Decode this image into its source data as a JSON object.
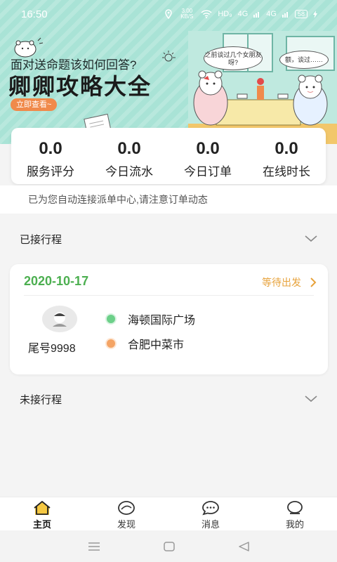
{
  "status_bar": {
    "time": "16:50",
    "speed": "3.00 KB/S",
    "network": "HD₉",
    "signal1": "4G",
    "signal2": "4G",
    "battery": "58"
  },
  "banner": {
    "question": "面对送命题该如何回答?",
    "title": "卿卿攻略大全",
    "cta_label": "立即查看~",
    "bubble_left": "之前谈过几个女朋友呀?",
    "bubble_right": "额，谈过……"
  },
  "stats": [
    {
      "value": "0.0",
      "label": "服务评分"
    },
    {
      "value": "0.0",
      "label": "今日流水"
    },
    {
      "value": "0.0",
      "label": "今日订单"
    },
    {
      "value": "0.0",
      "label": "在线时长"
    }
  ],
  "notice": "已为您自动连接派单中心,请注意订单动态",
  "accepted_section": {
    "title": "已接行程"
  },
  "trip": {
    "date": "2020-10-17",
    "status": "等待出发",
    "passenger_tail": "尾号9998",
    "origin": "海顿国际广场",
    "destination": "合肥中菜市"
  },
  "pending_section": {
    "title": "未接行程"
  },
  "tabs": [
    {
      "label": "主页",
      "icon": "home-icon",
      "active": true
    },
    {
      "label": "发现",
      "icon": "discover-icon",
      "active": false
    },
    {
      "label": "消息",
      "icon": "message-icon",
      "active": false
    },
    {
      "label": "我的",
      "icon": "profile-icon",
      "active": false
    }
  ],
  "colors": {
    "banner_bg": "#a9e3d6",
    "accent_green": "#4caf50",
    "accent_orange": "#e7a23b",
    "cta_orange": "#f08a4b"
  }
}
